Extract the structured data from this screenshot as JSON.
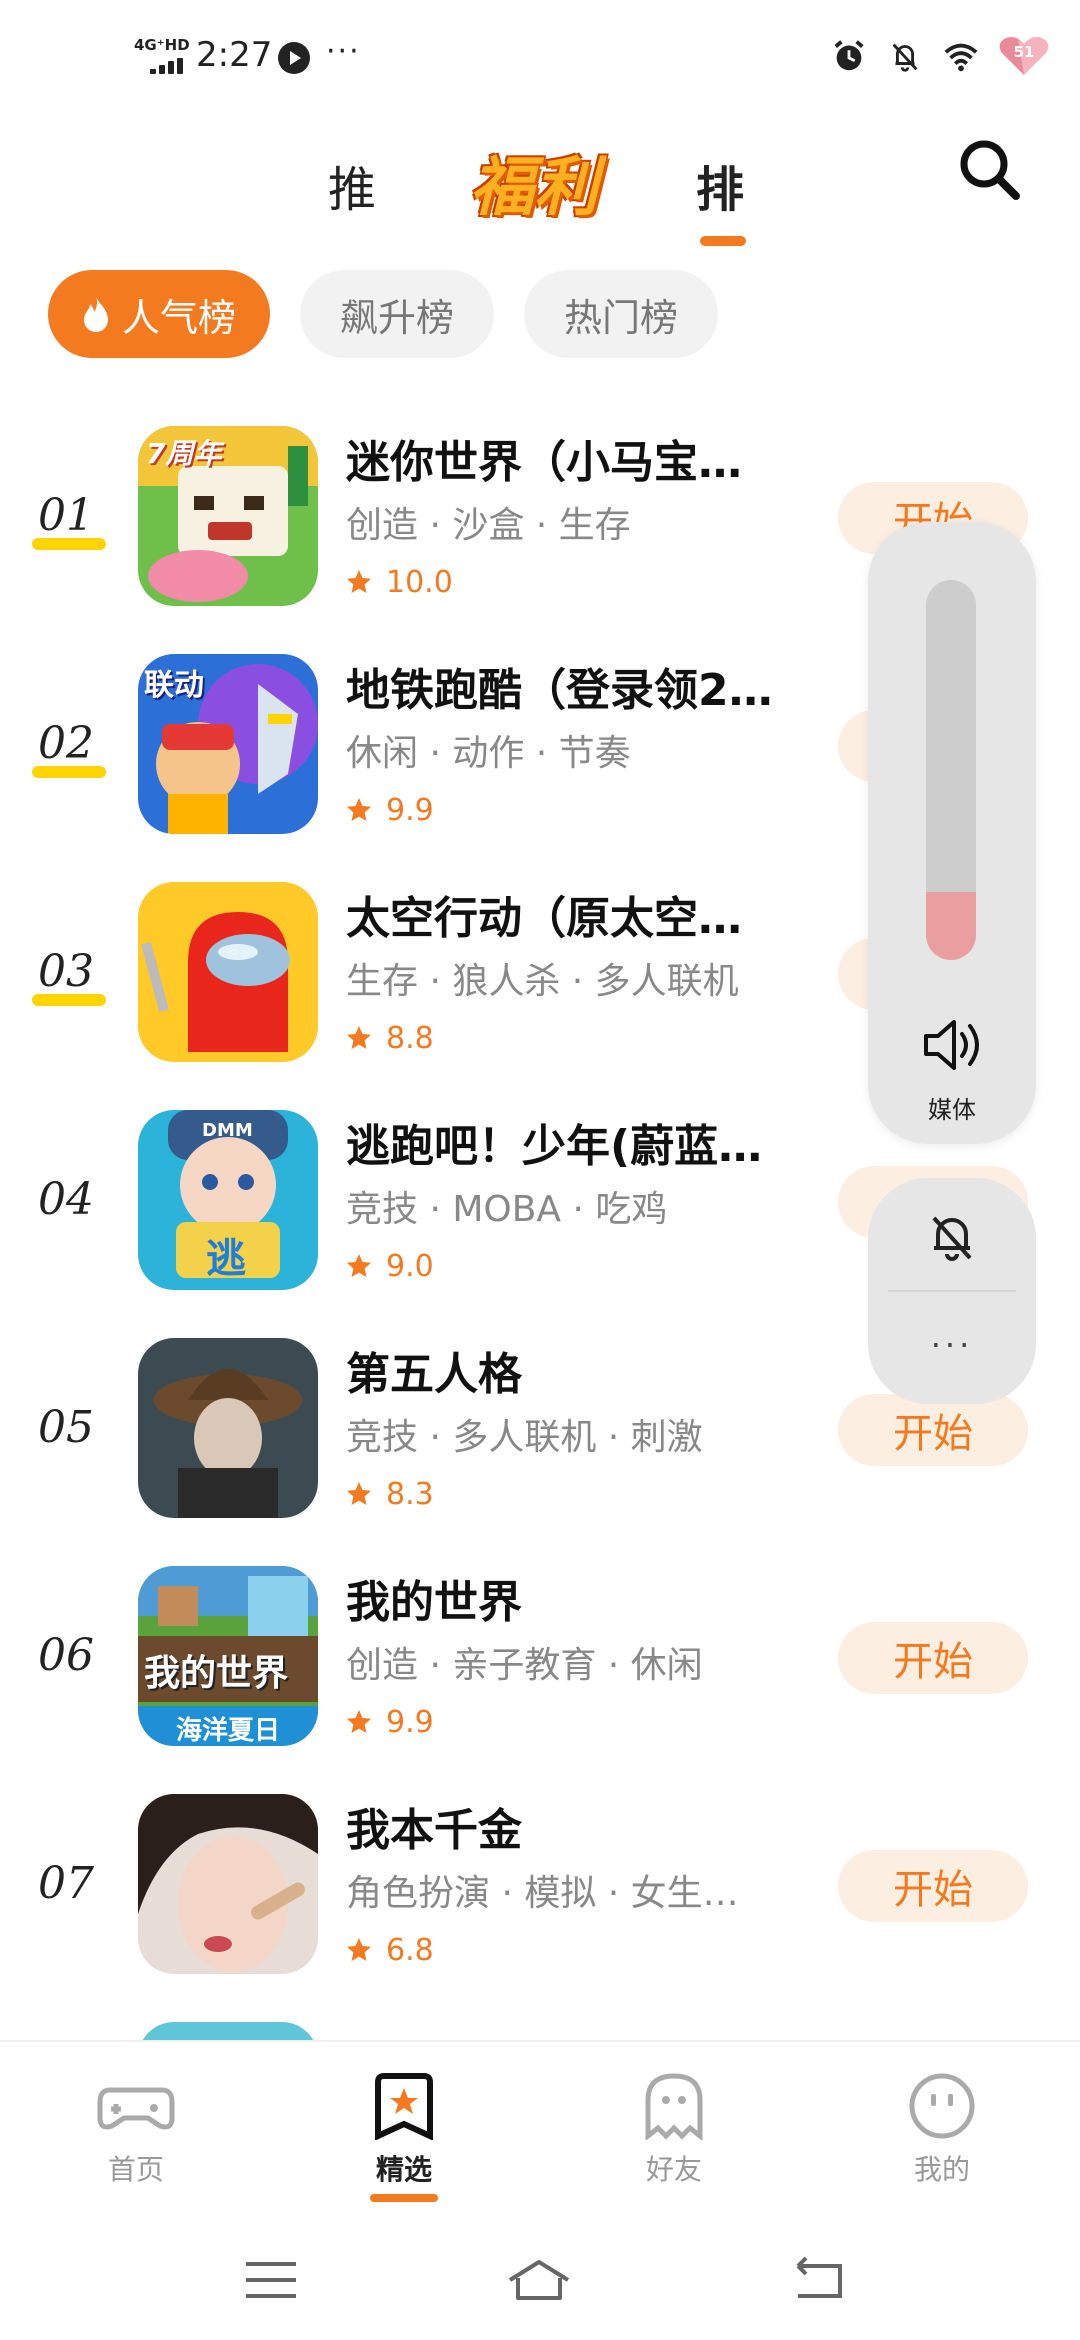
{
  "status_bar": {
    "network": "4G⁺HD",
    "time": "2:27",
    "more": "···",
    "battery": "51"
  },
  "top_tabs": {
    "tab1": "推",
    "tab2": "福利",
    "tab3": "排"
  },
  "chips": [
    {
      "label": "人气榜",
      "active": true
    },
    {
      "label": "飙升榜",
      "active": false
    },
    {
      "label": "热门榜",
      "active": false
    }
  ],
  "apps": [
    {
      "rank": "01",
      "name": "迷你世界（小马宝…",
      "tags": "创造 · 沙盒 · 生存",
      "score": "10.0",
      "button": "开始"
    },
    {
      "rank": "02",
      "name": "地铁跑酷（登录领2…",
      "tags": "休闲 · 动作 · 节奏",
      "score": "9.9",
      "button": "开始"
    },
    {
      "rank": "03",
      "name": "太空行动（原太空…",
      "tags": "生存 · 狼人杀 · 多人联机",
      "score": "8.8",
      "button": "开始"
    },
    {
      "rank": "04",
      "name": "逃跑吧！少年(蔚蓝…",
      "tags": "竞技 · MOBA · 吃鸡",
      "score": "9.0",
      "button": "开始"
    },
    {
      "rank": "05",
      "name": "第五人格",
      "tags": "竞技 · 多人联机 · 刺激",
      "score": "8.3",
      "button": "开始"
    },
    {
      "rank": "06",
      "name": "我的世界",
      "tags": "创造 · 亲子教育 · 休闲",
      "score": "9.9",
      "button": "开始"
    },
    {
      "rank": "07",
      "name": "我本千金",
      "tags": "角色扮演 · 模拟 · 女生…",
      "score": "6.8",
      "button": "开始"
    }
  ],
  "icon_labels": {
    "app1": "7周年",
    "app2": "联动",
    "app4": "DMM",
    "app4_badge": "逃",
    "app6": "我的世界",
    "app6_sub": "海洋夏日"
  },
  "volume": {
    "label": "媒体",
    "level": 0.18,
    "more": "···"
  },
  "bottom_nav": [
    {
      "label": "首页",
      "icon": "gamepad-icon",
      "active": false
    },
    {
      "label": "精选",
      "icon": "star-badge-icon",
      "active": true
    },
    {
      "label": "好友",
      "icon": "ghost-icon",
      "active": false
    },
    {
      "label": "我的",
      "icon": "smiley-icon",
      "active": false
    }
  ],
  "colors": {
    "accent": "#f47a1f",
    "rank_highlight": "#ffd400",
    "button_bg": "#fdeee2"
  }
}
